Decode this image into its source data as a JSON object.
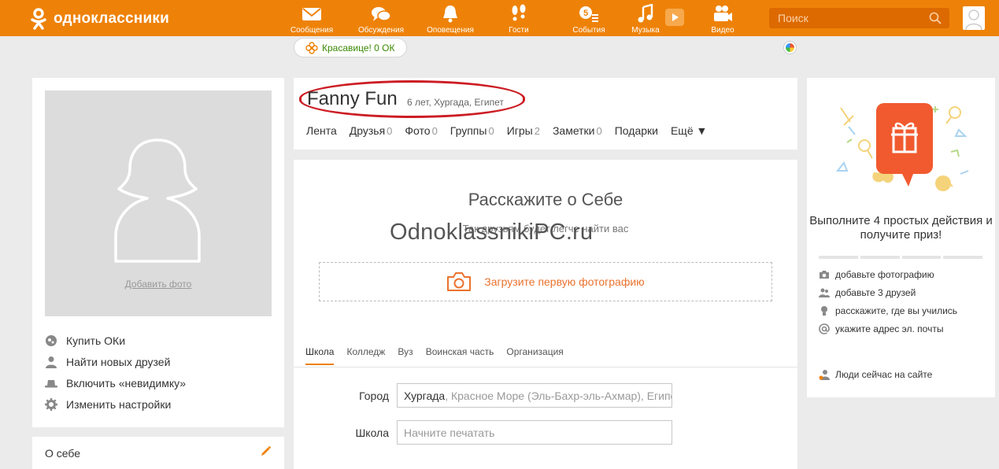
{
  "brand": {
    "name": "одноклассники",
    "accent": "#ee8208"
  },
  "nav": [
    {
      "icon": "envelope-icon",
      "label": "Сообщения"
    },
    {
      "icon": "chat-bubbles-icon",
      "label": "Обсуждения"
    },
    {
      "icon": "bell-icon",
      "label": "Оповещения"
    },
    {
      "icon": "footprints-icon",
      "label": "Гости"
    },
    {
      "icon": "events-icon",
      "label": "События"
    },
    {
      "icon": "music-note-icon",
      "label": "Музыка"
    },
    {
      "icon": "video-camera-icon",
      "label": "Видео"
    }
  ],
  "search": {
    "placeholder": "Поиск"
  },
  "promo": {
    "text": "Красавице! 0 ОК"
  },
  "profile": {
    "add_photo": "Добавить фото",
    "name": "Fanny Fun",
    "meta": "6 лет, Хургада, Египет"
  },
  "left_menu": [
    {
      "icon": "coins-icon",
      "label": "Купить ОКи"
    },
    {
      "icon": "person-icon",
      "label": "Найти новых друзей"
    },
    {
      "icon": "hat-icon",
      "label": "Включить «невидимку»"
    },
    {
      "icon": "gear-icon",
      "label": "Изменить настройки"
    }
  ],
  "about": {
    "label": "О себе"
  },
  "tabs": [
    {
      "label": "Лента",
      "count": ""
    },
    {
      "label": "Друзья",
      "count": "0"
    },
    {
      "label": "Фото",
      "count": "0"
    },
    {
      "label": "Группы",
      "count": "0"
    },
    {
      "label": "Игры",
      "count": "2"
    },
    {
      "label": "Заметки",
      "count": "0"
    },
    {
      "label": "Подарки",
      "count": ""
    },
    {
      "label": "Ещё ▼",
      "count": ""
    }
  ],
  "center": {
    "title": "Расскажите о Себе",
    "subtitle": "Так друзьям будет легче найти вас",
    "watermark": "OdnoklassnikiPC.ru",
    "upload": "Загрузите первую фотографию"
  },
  "edu_tabs": [
    "Школа",
    "Колледж",
    "Вуз",
    "Воинская часть",
    "Организация"
  ],
  "form": {
    "city_label": "Город",
    "city_value_strong": "Хургада",
    "city_value_rest": ", Красное Море (Эль-Бахр-эль-Ахмар), Египет",
    "school_label": "Школа",
    "school_placeholder": "Начните печатать"
  },
  "right": {
    "prize": "Выполните 4 простых действия и получите приз!",
    "tasks": [
      {
        "icon": "camera-icon",
        "label": "добавьте фотографию"
      },
      {
        "icon": "friends-icon",
        "label": "добавьте 3 друзей"
      },
      {
        "icon": "graduation-icon",
        "label": "расскажите, где вы учились"
      },
      {
        "icon": "at-icon",
        "label": "укажите адрес эл. почты"
      }
    ],
    "progress_done": 0,
    "online": "Люди сейчас на сайте"
  }
}
